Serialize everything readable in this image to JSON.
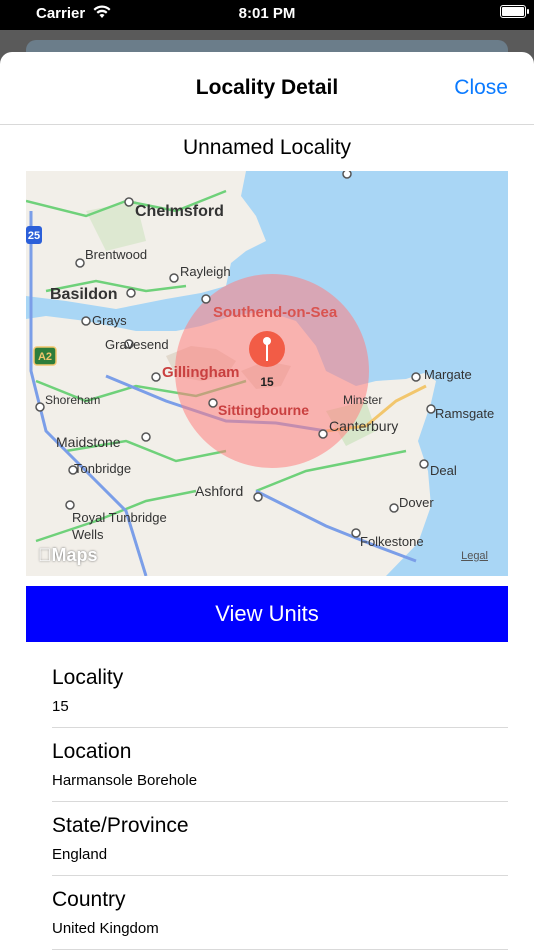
{
  "status": {
    "carrier": "Carrier",
    "time": "8:01 PM"
  },
  "nav": {
    "title": "Locality Detail",
    "close_label": "Close"
  },
  "locality_title": "Unnamed Locality",
  "map": {
    "pin_label": "15",
    "maps_label": "Maps",
    "legal_label": "Legal",
    "place_labels": {
      "chelmsford": "Chelmsford",
      "brentwood": "Brentwood",
      "rayleigh": "Rayleigh",
      "basildon": "Basildon",
      "grays": "Grays",
      "gravesend": "Gravesend",
      "southend": "Southend-on-Sea",
      "gillingham": "Gillingham",
      "margate": "Margate",
      "shoreham": "Shoreham",
      "minster": "Minster",
      "ramsgate": "Ramsgate",
      "sittingbourne": "Sittingbourne",
      "maidstone": "Maidstone",
      "canterbury": "Canterbury",
      "tonbridge": "Tonbridge",
      "deal": "Deal",
      "ashford": "Ashford",
      "royal_tunbridge_wells_1": "Royal Tunbridge",
      "royal_tunbridge_wells_2": "Wells",
      "dover": "Dover",
      "folkestone": "Folkestone",
      "road_a2": "A2",
      "road_25": "25"
    }
  },
  "view_units_label": "View Units",
  "details": [
    {
      "label": "Locality",
      "value": "15"
    },
    {
      "label": "Location",
      "value": "Harmansole Borehole"
    },
    {
      "label": "State/Province",
      "value": "England"
    },
    {
      "label": "Country",
      "value": "United Kingdom"
    }
  ],
  "colors": {
    "accent": "#0a7aff",
    "button": "#0000ff",
    "sea": "#a9d6f5",
    "land": "#f2efe9",
    "radius_fill": "#ff8080"
  }
}
